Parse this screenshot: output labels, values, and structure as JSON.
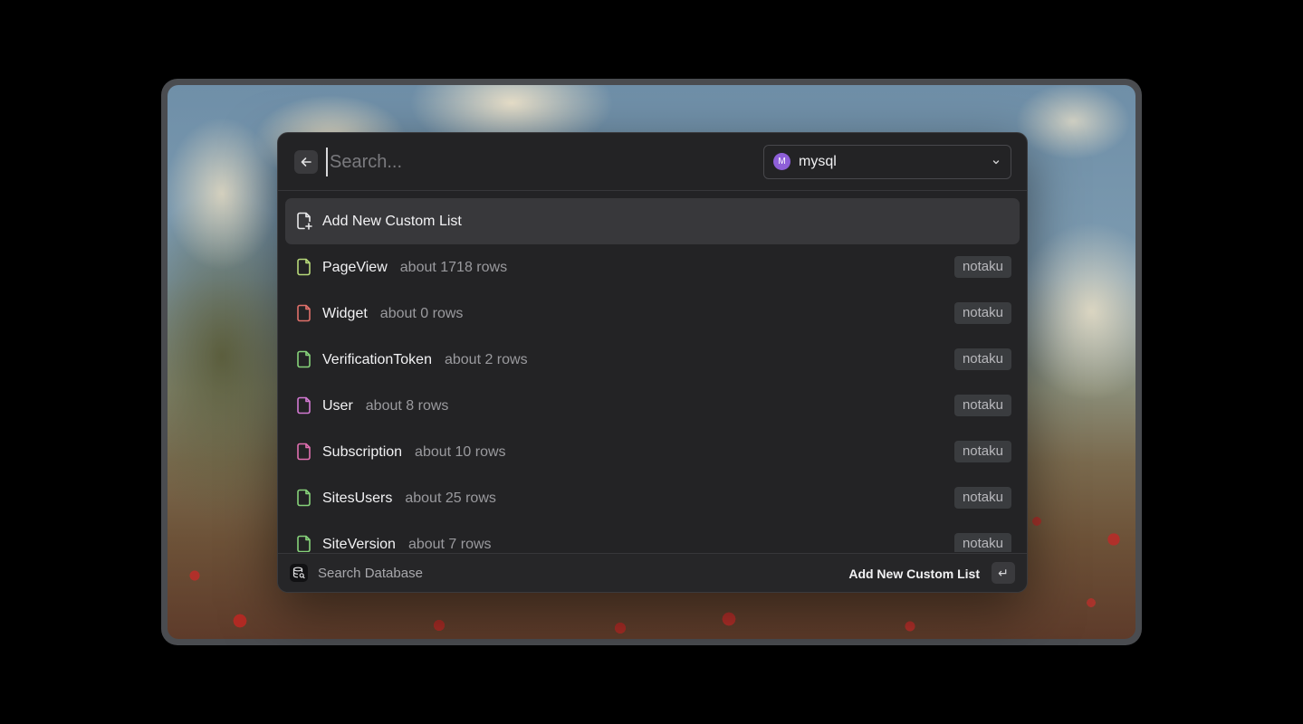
{
  "search": {
    "placeholder": "Search...",
    "value": ""
  },
  "database": {
    "avatar_letter": "M",
    "name": "mysql",
    "avatar_color": "#8e5fd8"
  },
  "items": [
    {
      "title": "Add New Custom List",
      "subtitle": "",
      "tag": "",
      "icon": "file-plus-icon",
      "color": "#e8e8ea",
      "selected": true
    },
    {
      "title": "PageView",
      "subtitle": "about 1718 rows",
      "tag": "notaku",
      "icon": "file-icon",
      "color": "#b7d97a"
    },
    {
      "title": "Widget",
      "subtitle": "about 0 rows",
      "tag": "notaku",
      "icon": "file-icon",
      "color": "#e0706a"
    },
    {
      "title": "VerificationToken",
      "subtitle": "about 2 rows",
      "tag": "notaku",
      "icon": "file-icon",
      "color": "#86d27a"
    },
    {
      "title": "User",
      "subtitle": "about 8 rows",
      "tag": "notaku",
      "icon": "file-icon",
      "color": "#d279d2"
    },
    {
      "title": "Subscription",
      "subtitle": "about 10 rows",
      "tag": "notaku",
      "icon": "file-icon",
      "color": "#e06fb0"
    },
    {
      "title": "SitesUsers",
      "subtitle": "about 25 rows",
      "tag": "notaku",
      "icon": "file-icon",
      "color": "#86d27a"
    },
    {
      "title": "SiteVersion",
      "subtitle": "about 7 rows",
      "tag": "notaku",
      "icon": "file-icon",
      "color": "#86d27a"
    }
  ],
  "footer": {
    "label": "Search Database",
    "action": "Add New Custom List",
    "enter_glyph": "↵"
  }
}
